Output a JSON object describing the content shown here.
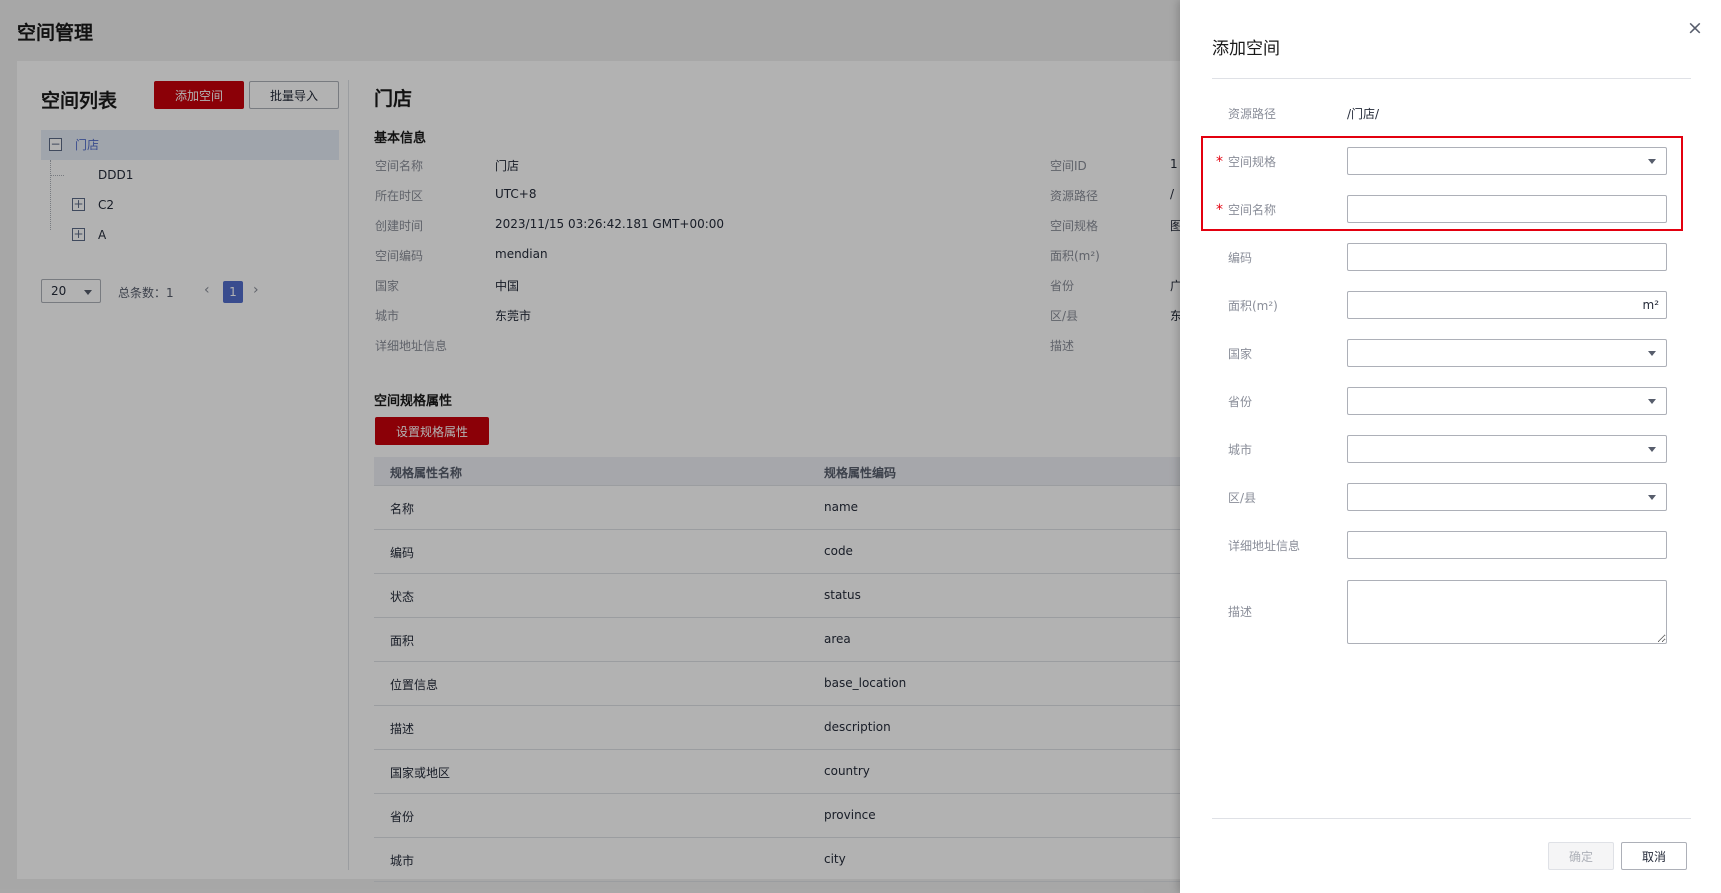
{
  "page": {
    "title": "空间管理"
  },
  "space_list": {
    "title": "空间列表",
    "add_button": "添加空间",
    "import_button": "批量导入",
    "tree": [
      {
        "label": "门店",
        "toggle": "−"
      },
      {
        "label": "DDD1"
      },
      {
        "label": "C2",
        "toggle": "+"
      },
      {
        "label": "A",
        "toggle": "+"
      }
    ],
    "pager": {
      "page_size": "20",
      "total": "总条数：1",
      "prev": "‹",
      "current": "1",
      "next": "›"
    }
  },
  "detail": {
    "title": "门店",
    "basic_info_title": "基本信息",
    "left_fields": [
      {
        "label": "空间名称",
        "value": "门店"
      },
      {
        "label": "所在时区",
        "value": "UTC+8"
      },
      {
        "label": "创建时间",
        "value": "2023/11/15 03:26:42.181 GMT+00:00"
      },
      {
        "label": "空间编码",
        "value": "mendian"
      },
      {
        "label": "国家",
        "value": "中国"
      },
      {
        "label": "城市",
        "value": "东莞市"
      },
      {
        "label": "详细地址信息",
        "value": ""
      }
    ],
    "right_fields": [
      {
        "label": "空间ID",
        "value": "1"
      },
      {
        "label": "资源路径",
        "value": "/"
      },
      {
        "label": "空间规格",
        "value": "图"
      },
      {
        "label": "面积(m²)",
        "value": ""
      },
      {
        "label": "省份",
        "value": "广"
      },
      {
        "label": "区/县",
        "value": "东"
      },
      {
        "label": "描述",
        "value": ""
      }
    ],
    "spec_section_title": "空间规格属性",
    "spec_button": "设置规格属性",
    "table": {
      "headers": [
        "规格属性名称",
        "规格属性编码"
      ],
      "rows": [
        [
          "名称",
          "name"
        ],
        [
          "编码",
          "code"
        ],
        [
          "状态",
          "status"
        ],
        [
          "面积",
          "area"
        ],
        [
          "位置信息",
          "base_location"
        ],
        [
          "描述",
          "description"
        ],
        [
          "国家或地区",
          "country"
        ],
        [
          "省份",
          "province"
        ],
        [
          "城市",
          "city"
        ]
      ]
    }
  },
  "drawer": {
    "title": "添加空间",
    "close": "×",
    "resource_path_label": "资源路径",
    "resource_path_value": "/门店/",
    "required_mark": "*",
    "spec_label": "空间规格",
    "name_label": "空间名称",
    "code_label": "编码",
    "area_label": "面积(m²)",
    "area_unit": "m²",
    "country_label": "国家",
    "province_label": "省份",
    "city_label": "城市",
    "district_label": "区/县",
    "address_label": "详细地址信息",
    "desc_label": "描述",
    "ok_button": "确定",
    "cancel_button": "取消"
  },
  "colors": {
    "brand_red": "#c7000b",
    "selected_blue": "#526ecc",
    "highlight_red": "#e3000f"
  }
}
